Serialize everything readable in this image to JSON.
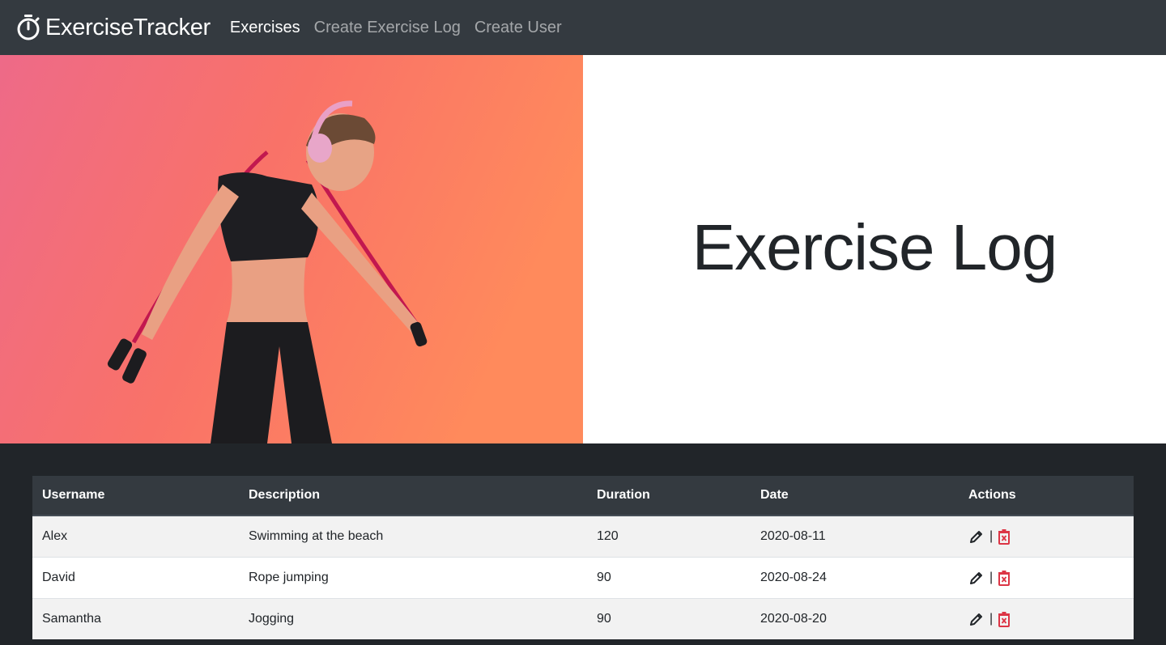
{
  "nav": {
    "brand": "ExerciseTracker",
    "links": [
      {
        "label": "Exercises",
        "active": true
      },
      {
        "label": "Create Exercise Log",
        "active": false
      },
      {
        "label": "Create User",
        "active": false
      }
    ]
  },
  "hero": {
    "title": "Exercise Log",
    "image_alt_icon": "woman-jump-rope-photo"
  },
  "table": {
    "headers": [
      "Username",
      "Description",
      "Duration",
      "Date",
      "Actions"
    ],
    "rows": [
      {
        "username": "Alex",
        "description": "Swimming at the beach",
        "duration": "120",
        "date": "2020-08-11"
      },
      {
        "username": "David",
        "description": "Rope jumping",
        "duration": "90",
        "date": "2020-08-24"
      },
      {
        "username": "Samantha",
        "description": "Jogging",
        "duration": "90",
        "date": "2020-08-20"
      }
    ],
    "action_separator": "|",
    "icons": {
      "edit": "pencil-icon",
      "delete": "trash-icon"
    }
  },
  "colors": {
    "navbar": "#343a40",
    "page_dark": "#212529",
    "delete_icon": "#dc3545",
    "hero_gradient_start": "#ef6a86",
    "hero_gradient_end": "#ff8a5c"
  }
}
